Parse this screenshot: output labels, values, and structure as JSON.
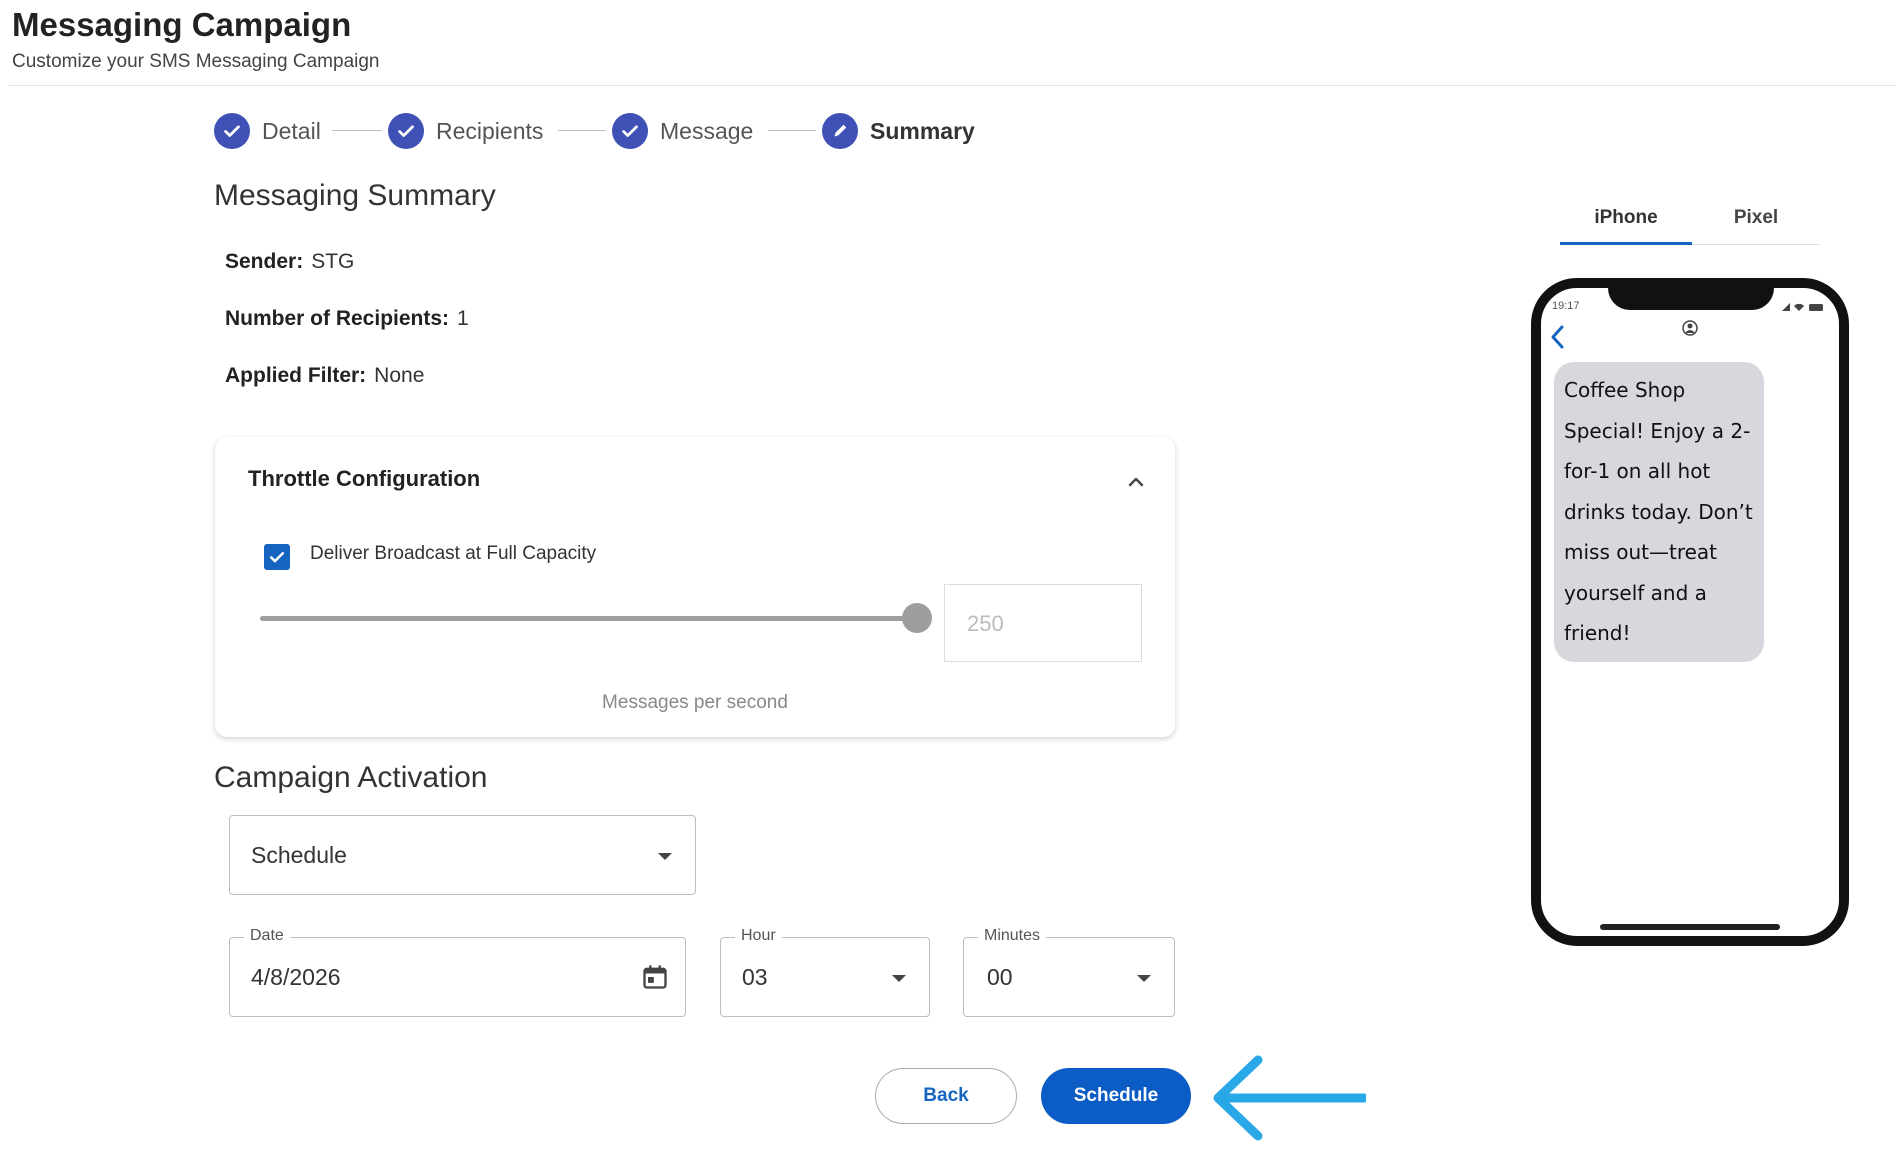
{
  "header": {
    "title": "Messaging Campaign",
    "subtitle": "Customize your SMS Messaging Campaign"
  },
  "stepper": {
    "steps": [
      {
        "label": "Detail",
        "state": "completed"
      },
      {
        "label": "Recipients",
        "state": "completed"
      },
      {
        "label": "Message",
        "state": "completed"
      },
      {
        "label": "Summary",
        "state": "active"
      }
    ]
  },
  "summary": {
    "heading": "Messaging Summary",
    "sender_label": "Sender:",
    "sender_value": "STG",
    "recipients_label": "Number of Recipients:",
    "recipients_value": "1",
    "filter_label": "Applied Filter:",
    "filter_value": "None"
  },
  "throttle": {
    "title": "Throttle Configuration",
    "expanded": true,
    "full_capacity_label": "Deliver Broadcast at Full Capacity",
    "full_capacity_checked": true,
    "rate_value": "250",
    "rate_fraction": 1.0,
    "rate_unit": "Messages per second"
  },
  "activation": {
    "heading": "Campaign Activation",
    "mode_value": "Schedule",
    "date_label": "Date",
    "date_value": "4/8/2026",
    "hour_label": "Hour",
    "hour_value": "03",
    "minutes_label": "Minutes",
    "minutes_value": "00"
  },
  "actions": {
    "back_label": "Back",
    "schedule_label": "Schedule"
  },
  "preview": {
    "tabs": [
      {
        "label": "iPhone",
        "active": true
      },
      {
        "label": "Pixel",
        "active": false
      }
    ],
    "status_time": "19:17",
    "message": "Coffee Shop Special! Enjoy a 2-for-1 on all hot drinks today. Don’t miss out—treat yourself and a friend!"
  },
  "colors": {
    "accent": "#3f51b5",
    "primary_button": "#0b5cc4",
    "pointer_arrow": "#29a8e8",
    "bubble": "#d6d8de"
  }
}
